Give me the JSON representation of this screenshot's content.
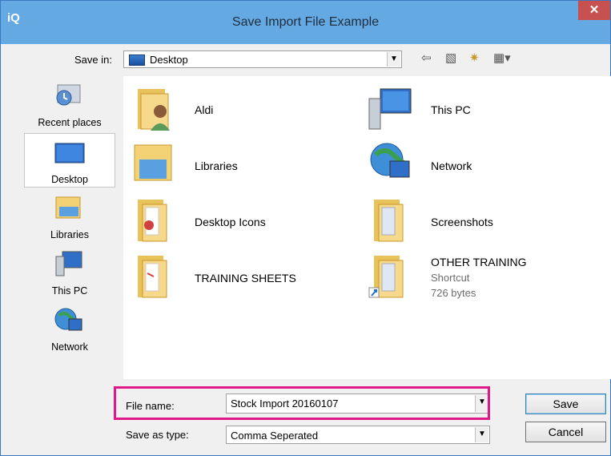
{
  "window": {
    "app_icon": "iQ",
    "title": "Save Import File Example",
    "close_glyph": "✕"
  },
  "savein": {
    "label": "Save in:",
    "value": "Desktop"
  },
  "places": [
    {
      "label": "Recent places",
      "icon": "recent-places-icon"
    },
    {
      "label": "Desktop",
      "icon": "desktop-icon",
      "selected": true
    },
    {
      "label": "Libraries",
      "icon": "libraries-icon"
    },
    {
      "label": "This PC",
      "icon": "this-pc-icon"
    },
    {
      "label": "Network",
      "icon": "network-icon"
    }
  ],
  "files": [
    {
      "name": "Aldi",
      "icon": "user-folder-icon"
    },
    {
      "name": "This PC",
      "icon": "computer-icon"
    },
    {
      "name": "Libraries",
      "icon": "libraries-folder-icon"
    },
    {
      "name": "Network",
      "icon": "network-globe-icon"
    },
    {
      "name": "Desktop Icons",
      "icon": "folder-icon"
    },
    {
      "name": "Screenshots",
      "icon": "folder-icon"
    },
    {
      "name": "TRAINING SHEETS",
      "icon": "folder-icon"
    },
    {
      "name": "OTHER TRAINING",
      "icon": "folder-shortcut-icon",
      "type": "Shortcut",
      "size": "726 bytes"
    }
  ],
  "filename": {
    "label": "File name:",
    "value": "Stock Import 20160107"
  },
  "filetype": {
    "label": "Save as type:",
    "value": "Comma Seperated"
  },
  "buttons": {
    "save": "Save",
    "cancel": "Cancel"
  },
  "colors": {
    "titlebar": "#65a9e3",
    "close": "#c75050",
    "highlight": "#e0198a"
  }
}
